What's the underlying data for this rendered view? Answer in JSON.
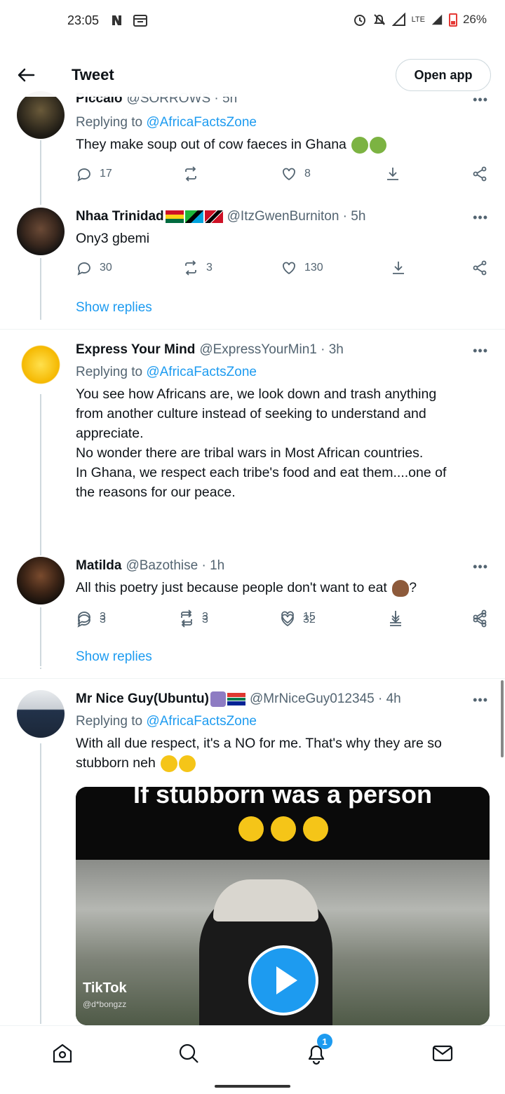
{
  "status": {
    "time": "23:05",
    "network": "LTE",
    "battery": "26%"
  },
  "header": {
    "title": "Tweet",
    "open_app": "Open app"
  },
  "tweets": [
    {
      "name": "Piccalo",
      "handle": "@SORROWS · 5h",
      "replying_prefix": "Replying to ",
      "replying_to": "@AfricaFactsZone",
      "text": "They make soup out of cow faeces in Ghana",
      "replies": "17",
      "retweets": "",
      "likes": "8"
    },
    {
      "name": "Nhaa Trinidad",
      "handle": "@ItzGwenBurniton · 5h",
      "text": "Ony3 gbemi",
      "replies": "30",
      "retweets": "3",
      "likes": "130",
      "show_replies": "Show replies"
    },
    {
      "name": "Express Your Mind",
      "handle": "@ExpressYourMin1 · 3h",
      "replying_prefix": "Replying to ",
      "replying_to": "@AfricaFactsZone",
      "text_lines": [
        "You see how Africans are, we look down and trash anything",
        "from another culture instead of seeking to understand and",
        "appreciate.",
        "No wonder there are tribal wars in Most African countries.",
        "In Ghana, we respect each tribe's food and eat them....one of",
        "the reasons for our peace."
      ],
      "replies": "3",
      "retweets": "3",
      "likes": "32"
    },
    {
      "name": "Matilda",
      "handle": "@Bazothise · 1h",
      "text": "All this poetry just because people don't want to eat",
      "text_suffix": "?",
      "replies": "3",
      "retweets": "3",
      "likes": "15",
      "show_replies": "Show replies"
    },
    {
      "name": "Mr Nice Guy(Ubuntu)",
      "handle": "@MrNiceGuy012345 · 4h",
      "replying_prefix": "Replying to ",
      "replying_to": "@AfricaFactsZone",
      "text_lines": [
        "With all due respect, it's a NO for me. That's why they are so",
        "stubborn neh"
      ],
      "media": {
        "caption": "If stubborn was a person",
        "watermark": "TikTok",
        "watermark_handle": "@d*bongzz"
      }
    }
  ],
  "more": "•••",
  "nav": {
    "notifications_badge": "1"
  },
  "colors": {
    "accent": "#1d9bf0",
    "text": "#0f1419",
    "muted": "#536471",
    "divider": "#eff3f4"
  }
}
